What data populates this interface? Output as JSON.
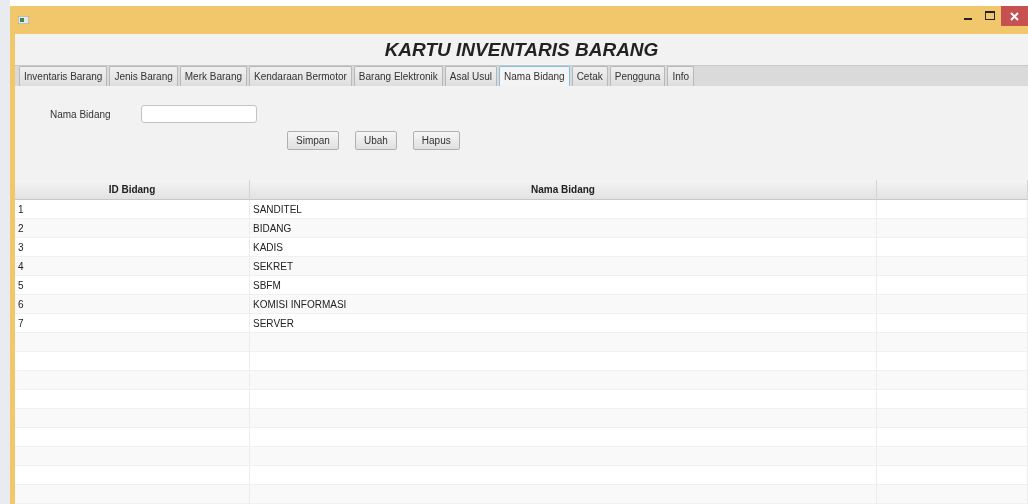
{
  "window": {
    "title": "KARTU INVENTARIS BARANG"
  },
  "tabs": [
    {
      "label": "Inventaris Barang",
      "selected": false
    },
    {
      "label": "Jenis Barang",
      "selected": false
    },
    {
      "label": "Merk Barang",
      "selected": false
    },
    {
      "label": "Kendaraan Bermotor",
      "selected": false
    },
    {
      "label": "Barang Elektronik",
      "selected": false
    },
    {
      "label": "Asal Usul",
      "selected": false
    },
    {
      "label": "Nama Bidang",
      "selected": true
    },
    {
      "label": "Cetak",
      "selected": false
    },
    {
      "label": "Pengguna",
      "selected": false
    },
    {
      "label": "Info",
      "selected": false
    }
  ],
  "form": {
    "label": "Nama Bidang",
    "buttons": [
      "Simpan",
      "Ubah",
      "Hapus"
    ]
  },
  "table": {
    "columns": [
      "ID Bidang",
      "Nama Bidang"
    ],
    "rows": [
      {
        "id": "1",
        "name": "SANDITEL"
      },
      {
        "id": "2",
        "name": "BIDANG"
      },
      {
        "id": "3",
        "name": "KADIS"
      },
      {
        "id": "4",
        "name": "SEKRET"
      },
      {
        "id": "5",
        "name": "SBFM"
      },
      {
        "id": "6",
        "name": "KOMISI INFORMASI"
      },
      {
        "id": "7",
        "name": "SERVER"
      }
    ]
  }
}
